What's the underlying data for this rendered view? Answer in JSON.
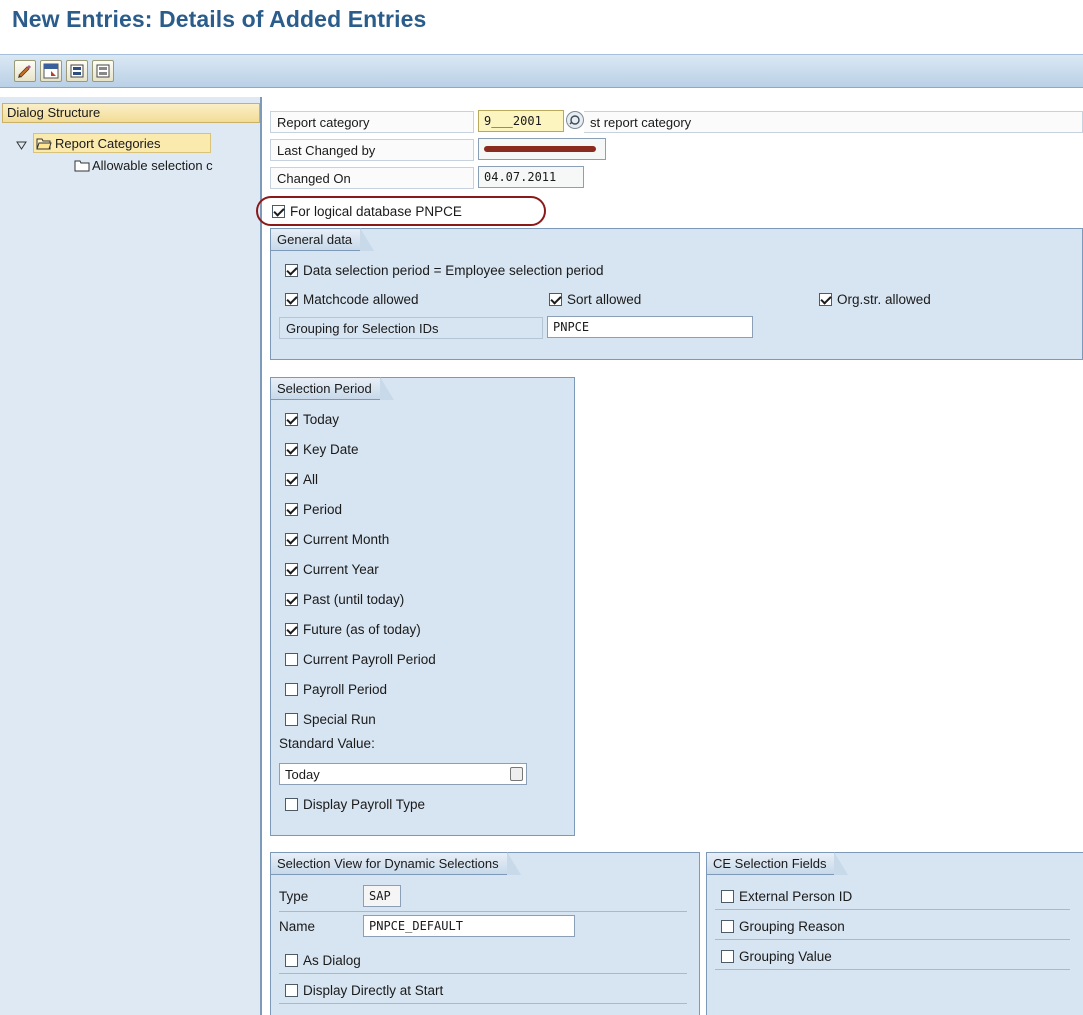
{
  "title": "New Entries: Details of Added Entries",
  "toolbar": {
    "buttons": [
      "edit-icon",
      "save-icon",
      "select-all-icon",
      "deselect-icon"
    ]
  },
  "dialog_structure": {
    "header": "Dialog Structure",
    "items": [
      {
        "label": "Report Categories",
        "expanded": true,
        "selected": true
      },
      {
        "label": "Allowable selection c",
        "expanded": false,
        "selected": false
      }
    ]
  },
  "header_fields": {
    "report_category_label": "Report category",
    "report_category_value": "9___2001",
    "report_category_desc": "st report category",
    "last_changed_label": "Last Changed by",
    "changed_on_label": "Changed On",
    "changed_on_value": "04.07.2011"
  },
  "logical_db": {
    "label": "For logical database PNPCE",
    "checked": true
  },
  "general_data": {
    "tab": "General data",
    "data_sel_period": {
      "label": "Data selection period = Employee selection period",
      "checked": true
    },
    "matchcode": {
      "label": "Matchcode allowed",
      "checked": true
    },
    "sort": {
      "label": "Sort allowed",
      "checked": true
    },
    "orgstr": {
      "label": "Org.str. allowed",
      "checked": true
    },
    "grouping_label": "Grouping for Selection IDs",
    "grouping_value": "PNPCE"
  },
  "selection_period": {
    "tab": "Selection Period",
    "options": [
      {
        "label": "Today",
        "checked": true
      },
      {
        "label": "Key Date",
        "checked": true
      },
      {
        "label": "All",
        "checked": true
      },
      {
        "label": "Period",
        "checked": true
      },
      {
        "label": "Current Month",
        "checked": true
      },
      {
        "label": "Current Year",
        "checked": true
      },
      {
        "label": "Past (until today)",
        "checked": true
      },
      {
        "label": "Future (as of today)",
        "checked": true
      },
      {
        "label": "Current Payroll Period",
        "checked": false
      },
      {
        "label": "Payroll Period",
        "checked": false
      },
      {
        "label": "Special Run",
        "checked": false
      }
    ],
    "standard_value_label": "Standard Value:",
    "standard_value": "Today",
    "display_payroll_type": {
      "label": "Display Payroll Type",
      "checked": false
    }
  },
  "selection_view": {
    "tab": "Selection View for Dynamic Selections",
    "type_label": "Type",
    "type_value": "SAP",
    "name_label": "Name",
    "name_value": "PNPCE_DEFAULT",
    "as_dialog": {
      "label": "As Dialog",
      "checked": false
    },
    "display_at_start": {
      "label": "Display Directly at Start",
      "checked": false
    }
  },
  "ce_fields": {
    "tab": "CE Selection Fields",
    "options": [
      {
        "label": "External Person ID",
        "checked": false
      },
      {
        "label": "Grouping Reason",
        "checked": false
      },
      {
        "label": "Grouping Value",
        "checked": false
      }
    ]
  }
}
